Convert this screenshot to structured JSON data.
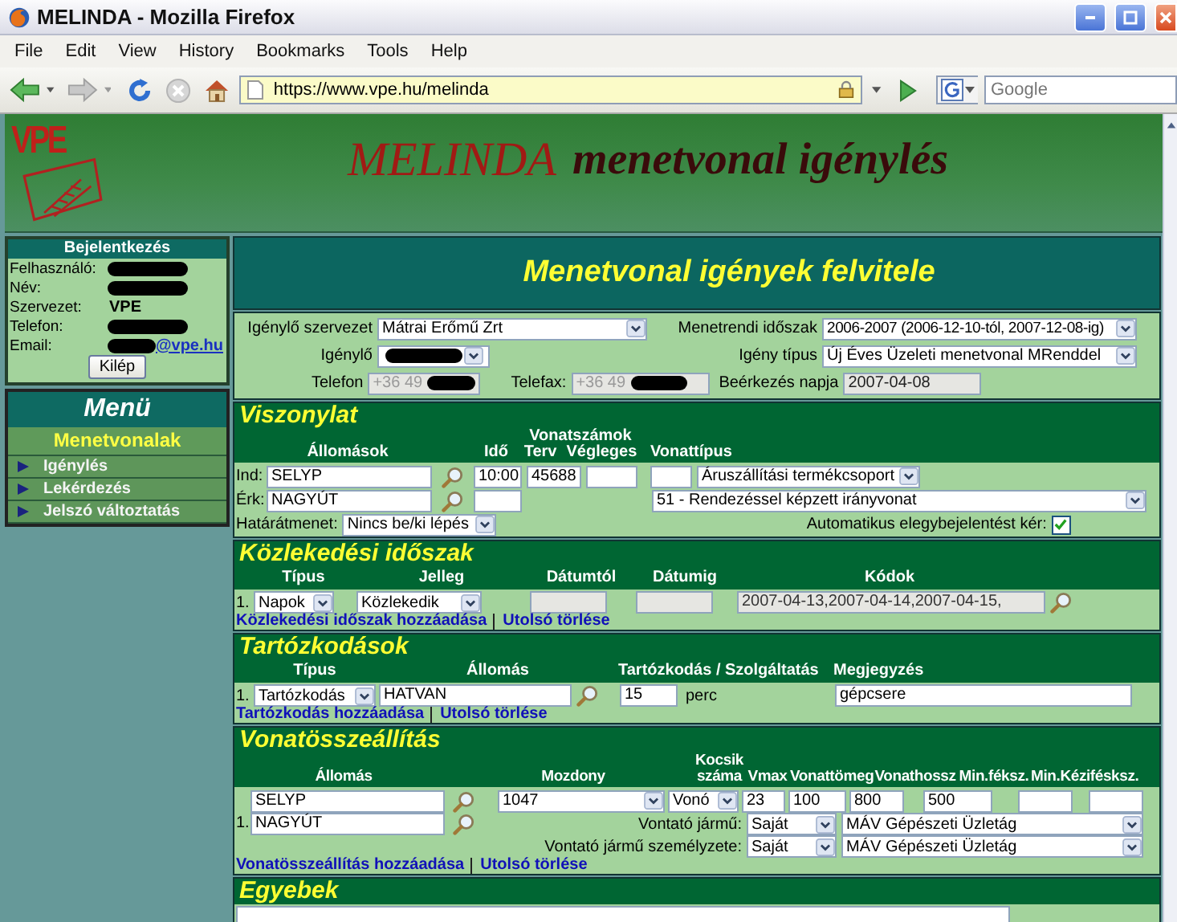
{
  "window": {
    "title": "MELINDA - Mozilla Firefox"
  },
  "menu_bar": [
    "File",
    "Edit",
    "View",
    "History",
    "Bookmarks",
    "Tools",
    "Help"
  ],
  "address_bar": {
    "url": "https://www.vpe.hu/melinda"
  },
  "search": {
    "placeholder": "Google"
  },
  "banner": {
    "logo": "VPE",
    "title": "MELINDA",
    "subtitle": "menetvonal igénylés"
  },
  "login": {
    "title": "Bejelentkezés",
    "rows": [
      {
        "label": "Felhasználó:",
        "redacted": true
      },
      {
        "label": "Név:",
        "redacted": true
      },
      {
        "label": "Szervezet:",
        "value": "VPE"
      },
      {
        "label": "Telefon:",
        "redacted": true
      },
      {
        "label": "Email:",
        "redacted": true,
        "value": "@vpe.hu"
      }
    ],
    "button": "Kilép"
  },
  "menu": {
    "title": "Menü",
    "section": "Menetvonalak",
    "items": [
      "Igénylés",
      "Lekérdezés",
      "Jelszó változtatás"
    ]
  },
  "page_title": "Menetvonal igények felvitele",
  "request": {
    "organization": {
      "label": "Igénylő szervezet",
      "value": "Mátrai Erőmű Zrt"
    },
    "period": {
      "label": "Menetrendi időszak",
      "value": "2006-2007 (2006-12-10-tól, 2007-12-08-ig)"
    },
    "requester": {
      "label": "Igénylő",
      "redacted": true
    },
    "type": {
      "label": "Igény típus",
      "value": "Új Éves Üzeleti menetvonal MRenddel"
    },
    "phone": {
      "label": "Telefon",
      "value": "+36 49",
      "redacted": true,
      "disabled": true
    },
    "fax": {
      "label": "Telefax:",
      "value": "+36 49",
      "redacted": true,
      "disabled": true
    },
    "received": {
      "label": "Beérkezés napja",
      "value": "2007-04-08",
      "disabled": true
    }
  },
  "route": {
    "title": "Viszonylat",
    "headers": {
      "stations": "Állomások",
      "time": "Idő",
      "train_numbers": "Vonatszámok",
      "planned": "Terv",
      "final": "Végleges",
      "train_type": "Vonattípus"
    },
    "departure": {
      "label": "Ind:",
      "station": "SELYP",
      "time": "10:00",
      "planned": "45688",
      "train_type": "Áruszállítási termékcsoport"
    },
    "arrival": {
      "label": "Érk:",
      "station": "NAGYÚT",
      "train_subtype": "51 - Rendezéssel képzett irányvonat"
    },
    "border": {
      "label": "Határátmenet:",
      "value": "Nincs be/ki lépés"
    },
    "auto": {
      "label": "Automatikus elegybejelentést kér:",
      "checked": true
    }
  },
  "periods": {
    "title": "Közlekedési időszak",
    "headers": [
      "Típus",
      "Jelleg",
      "Dátumtól",
      "Dátumig",
      "Kódok"
    ],
    "rows": [
      {
        "number": "1.",
        "type": "Napok",
        "character": "Közlekedik",
        "from": {
          "disabled": true
        },
        "to": {
          "disabled": true
        },
        "codes": {
          "value": "2007-04-13,2007-04-14,2007-04-15,",
          "disabled": true
        }
      }
    ],
    "links": [
      "Közlekedési időszak hozzáadása",
      "Utolsó törlése"
    ]
  },
  "stops": {
    "title": "Tartózkodások",
    "headers": [
      "Típus",
      "Állomás",
      "Tartózkodás / Szolgáltatás",
      "Megjegyzés"
    ],
    "rows": [
      {
        "number": "1.",
        "type": "Tartózkodás",
        "station": "HATVAN",
        "duration": "15",
        "unit": "perc",
        "note": "gépcsere"
      }
    ],
    "links": [
      "Tartózkodás hozzáadása",
      "Utolsó törlése"
    ]
  },
  "composition": {
    "title": "Vonatösszeállítás",
    "headers": [
      "Állomás",
      "Mozdony",
      "Kocsik száma",
      "Vmax",
      "Vonattömeg",
      "Vonathossz",
      "Min.féksz.",
      "Min.Kézifésksz."
    ],
    "rows": [
      {
        "number": "1.",
        "from": "SELYP",
        "to": "NAGYÚT",
        "locomotive": "1047",
        "role": "Vonó",
        "wagons": "23",
        "vmax": "100",
        "weight": "800",
        "length": "500",
        "traction_vehicle": {
          "label": "Vontató jármű:",
          "owner": "Saját",
          "operator": "MÁV Gépészeti Üzletág"
        },
        "traction_crew": {
          "label": "Vontató jármű személyzete:",
          "owner": "Saját",
          "operator": "MÁV Gépészeti Üzletág"
        }
      }
    ],
    "links": [
      "Vonatösszeállítás hozzáadása",
      "Utolsó törlése"
    ]
  },
  "other": {
    "title": "Egyebek"
  }
}
